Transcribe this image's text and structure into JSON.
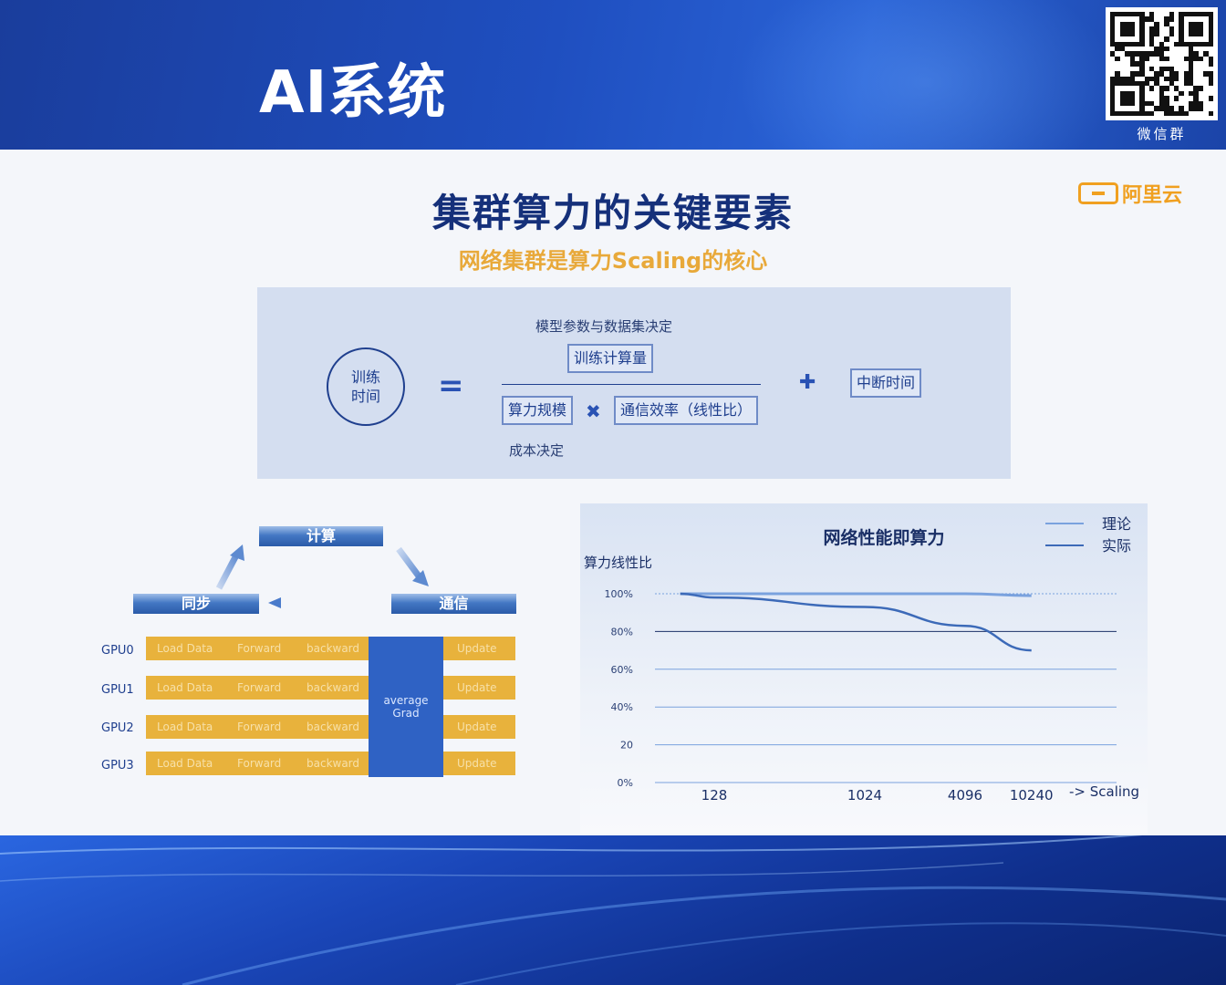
{
  "header": {
    "title": "AI系统",
    "qr_caption": "微信群"
  },
  "slide": {
    "title": "集群算力的关键要素",
    "subtitle": "网络集群是算力Scaling的核心",
    "brand": "阿里云"
  },
  "formula": {
    "lhs": "训练\n时间",
    "top_note": "模型参数与数据集决定",
    "numerator": "训练计算量",
    "denominator_left": "算力规模",
    "denominator_right": "通信效率（线性比）",
    "bottom_note": "成本决定",
    "extra": "中断时间",
    "equals": "=",
    "times": "✖",
    "plus": "✚"
  },
  "cycle": {
    "compute": "计算",
    "sync": "同步",
    "comm": "通信"
  },
  "gpu_table": {
    "rows": [
      "GPU0",
      "GPU1",
      "GPU2",
      "GPU3"
    ],
    "stages": [
      "Load Data",
      "Forward",
      "backward"
    ],
    "update": "Update",
    "average": "average",
    "grad": "Grad"
  },
  "chart_data": {
    "type": "line",
    "title": "网络性能即算力",
    "ylabel": "算力线性比",
    "xlabel": "-> Scaling",
    "categories": [
      "128",
      "1024",
      "4096",
      "10240"
    ],
    "yticks": [
      "0%",
      "20",
      "40%",
      "60%",
      "80%",
      "100%"
    ],
    "ylim": [
      0,
      100
    ],
    "x": [
      80,
      128,
      1024,
      4096,
      10240
    ],
    "series": [
      {
        "name": "理论",
        "values": [
          100,
          100,
          100,
          100,
          99
        ],
        "color": "#7aa2de"
      },
      {
        "name": "实际",
        "values": [
          100,
          98,
          93,
          83,
          70
        ],
        "color": "#3c6ab8"
      }
    ],
    "legend": "top-right",
    "grid": true
  },
  "colors": {
    "primary": "#1f4fc0",
    "title": "#15307a",
    "accent": "#e8a93a",
    "gpu_bar": "#e8b23c",
    "avg_block": "#2f62c4"
  }
}
